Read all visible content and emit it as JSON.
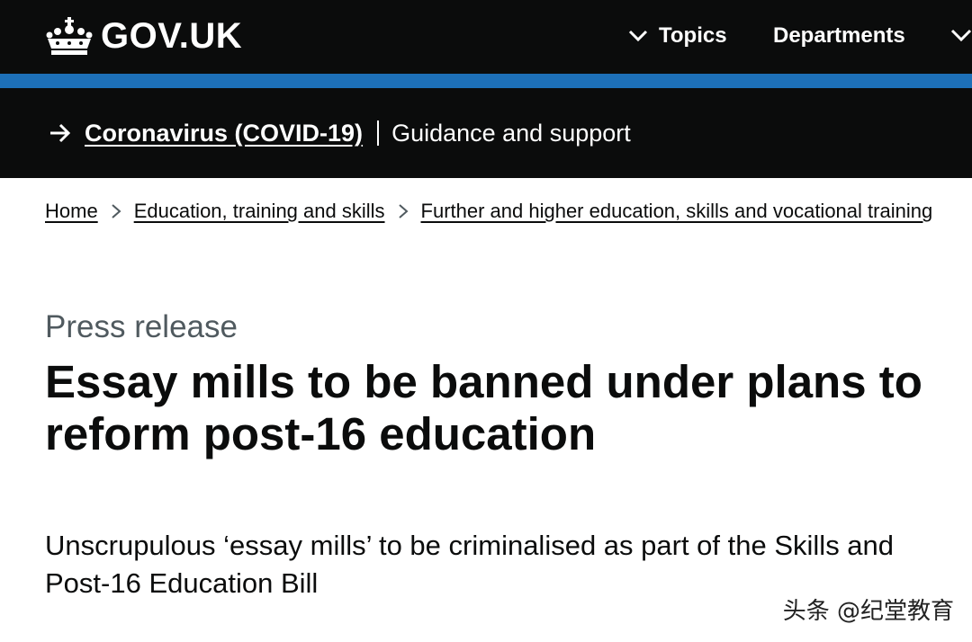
{
  "header": {
    "logo_text": "GOV.UK",
    "nav": {
      "topics_label": "Topics",
      "departments_label": "Departments"
    },
    "background_color": "#0b0c0c",
    "accent_color": "#1d70b8"
  },
  "covid_banner": {
    "link_label": "Coronavirus (COVID-19)",
    "guidance_label": "Guidance and support"
  },
  "breadcrumbs": [
    {
      "label": "Home"
    },
    {
      "label": "Education, training and skills"
    },
    {
      "label": "Further and higher education, skills and vocational training"
    }
  ],
  "main": {
    "caption": "Press release",
    "title": "Essay mills to be banned under plans to reform post-16 education",
    "lede": "Unscrupulous ‘essay mills’ to be criminalised as part of the Skills and Post-16 Education Bill"
  },
  "watermark": "头条 @纪堂教育",
  "icons": {
    "logo": "crown-icon",
    "nav": "chevron-down-icon",
    "banner": "arrow-right-icon",
    "breadcrumb": "chevron-right-icon"
  }
}
